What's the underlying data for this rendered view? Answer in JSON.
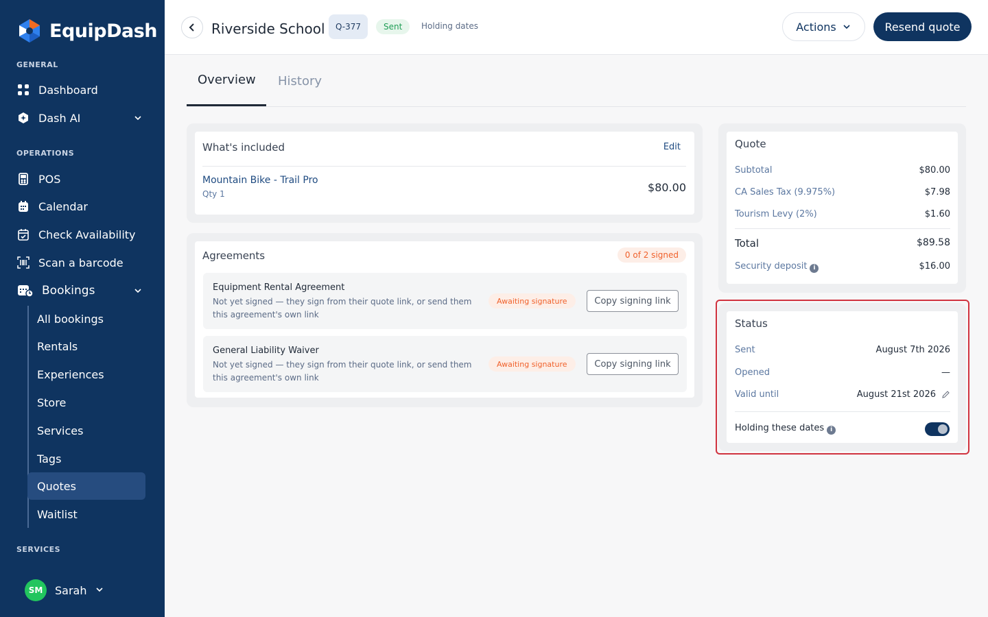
{
  "brand": {
    "name": "EquipDash",
    "colors": {
      "primary": "#0f3460",
      "logo_orange": "#f26b21",
      "logo_blue": "#2f80ed"
    }
  },
  "sidebar": {
    "sections": {
      "general": "GENERAL",
      "operations": "OPERATIONS",
      "services": "SERVICES"
    },
    "general_items": [
      {
        "label": "Dashboard",
        "icon": "grid-icon"
      },
      {
        "label": "Dash AI",
        "icon": "ai-shield-icon",
        "expandable": true
      }
    ],
    "operations_items": [
      {
        "label": "POS",
        "icon": "pos-terminal-icon"
      },
      {
        "label": "Calendar",
        "icon": "calendar-icon"
      },
      {
        "label": "Check Availability",
        "icon": "calendar-check-icon"
      },
      {
        "label": "Scan a barcode",
        "icon": "barcode-icon"
      },
      {
        "label": "Bookings",
        "icon": "bookings-icon",
        "expandable": true
      }
    ],
    "booking_subitems": [
      {
        "label": "All bookings"
      },
      {
        "label": "Rentals"
      },
      {
        "label": "Experiences"
      },
      {
        "label": "Store"
      },
      {
        "label": "Services"
      },
      {
        "label": "Tags"
      },
      {
        "label": "Quotes",
        "active": true
      },
      {
        "label": "Waitlist"
      }
    ],
    "user": {
      "initials": "SM",
      "name": "Sarah",
      "avatar_color": "#22c55e"
    }
  },
  "header": {
    "title": "Riverside School",
    "quote_code": "Q-377",
    "status": "Sent",
    "holding": "Holding dates",
    "actions_label": "Actions",
    "resend_label": "Resend quote"
  },
  "tabs": [
    {
      "label": "Overview",
      "active": true
    },
    {
      "label": "History",
      "active": false
    }
  ],
  "included": {
    "title": "What's included",
    "edit_label": "Edit",
    "items": [
      {
        "name": "Mountain Bike - Trail Pro",
        "qty": "Qty 1",
        "price": "$80.00"
      }
    ]
  },
  "agreements": {
    "title": "Agreements",
    "signed_count": "0 of 2 signed",
    "items": [
      {
        "name": "Equipment Rental Agreement",
        "description": "Not yet signed — they sign from their quote link, or send them this agreement's own link",
        "status": "Awaiting signature",
        "action": "Copy signing link"
      },
      {
        "name": "General Liability Waiver",
        "description": "Not yet signed — they sign from their quote link, or send them this agreement's own link",
        "status": "Awaiting signature",
        "action": "Copy signing link"
      }
    ]
  },
  "quote": {
    "title": "Quote",
    "lines": [
      {
        "label": "Subtotal",
        "value": "$80.00"
      },
      {
        "label": "CA Sales Tax (9.975%)",
        "value": "$7.98"
      },
      {
        "label": "Tourism Levy (2%)",
        "value": "$1.60"
      }
    ],
    "total_label": "Total",
    "total_value": "$89.58",
    "deposit_label": "Security deposit",
    "deposit_value": "$16.00"
  },
  "status_card": {
    "title": "Status",
    "sent_label": "Sent",
    "sent_value": "August 7th 2026",
    "opened_label": "Opened",
    "opened_value": "—",
    "valid_label": "Valid until",
    "valid_value": "August 21st 2026",
    "holding_label": "Holding these dates",
    "holding_on": true
  }
}
